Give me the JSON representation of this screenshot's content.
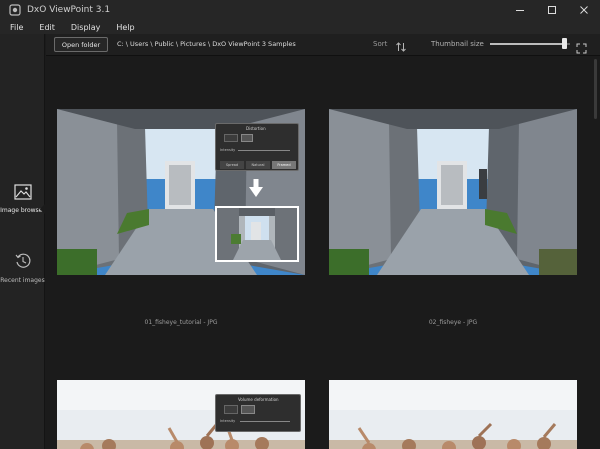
{
  "window": {
    "title": "DxO ViewPoint 3.1",
    "controls": [
      "minimize-icon",
      "maximize-icon",
      "close-icon"
    ]
  },
  "menu": {
    "items": [
      "File",
      "Edit",
      "Display",
      "Help"
    ]
  },
  "sidebar": {
    "items": [
      {
        "label": "Image browser",
        "icon": "image-browser-icon",
        "active": true
      },
      {
        "label": "Recent images",
        "icon": "recent-images-icon",
        "active": false
      }
    ]
  },
  "toolbar": {
    "open_folder": "Open folder",
    "path": "C: \\ Users \\ Public \\ Pictures \\ DxO ViewPoint 3 Samples",
    "sort_label": "Sort",
    "thumbnail_size_label": "Thumbnail size",
    "thumbnail_size_value": 0.93
  },
  "thumbnails": [
    {
      "caption": "01_fisheye_tutorial - JPG",
      "has_tutorial_overlay": true
    },
    {
      "caption": "02_fisheye - JPG",
      "has_tutorial_overlay": false
    },
    {
      "caption": "",
      "has_tutorial_overlay": true
    },
    {
      "caption": "",
      "has_tutorial_overlay": false
    }
  ],
  "tutorial_panels": {
    "distortion_title": "Distortion",
    "intensity_label": "Intensity",
    "modes": [
      "Spread",
      "Natural",
      "Framed"
    ],
    "volume_title": "Volume deformation"
  },
  "colors": {
    "accent": "#e6e6e6",
    "background": "#1b1b1b",
    "toolbar": "#1f1f1f",
    "sky": "#3f86c9"
  }
}
